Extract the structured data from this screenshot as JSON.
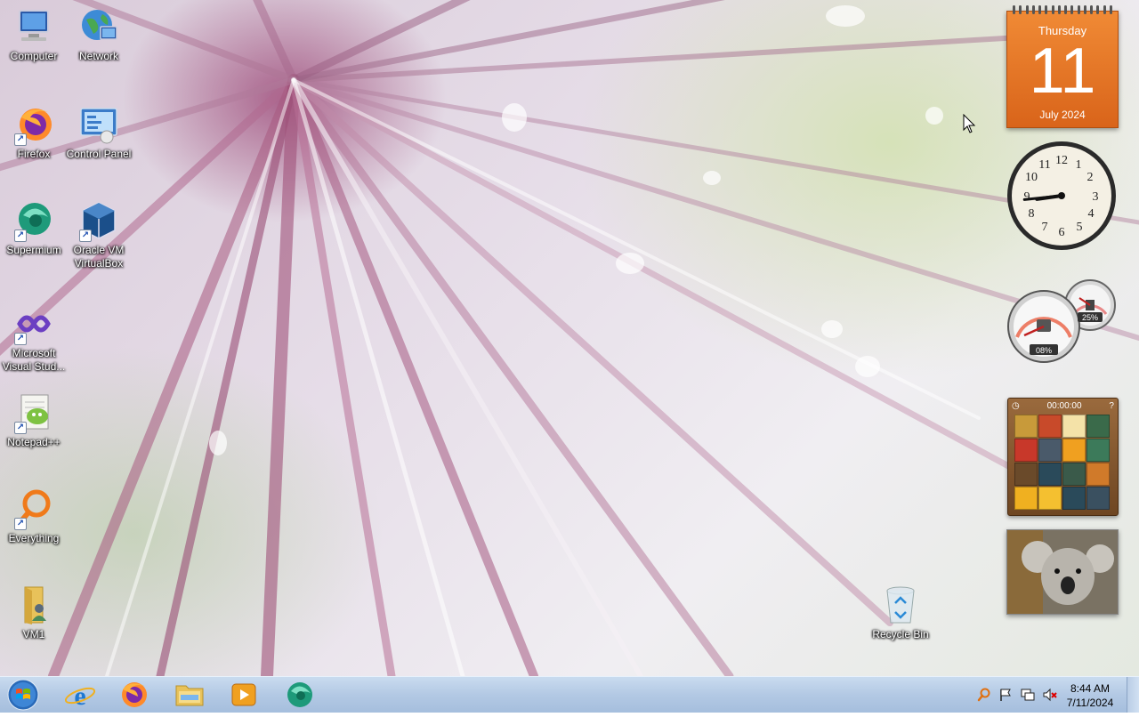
{
  "desktop_icons": [
    {
      "id": "computer",
      "label": "Computer",
      "icon": "computer-icon",
      "shortcut": false
    },
    {
      "id": "network",
      "label": "Network",
      "icon": "network-icon",
      "shortcut": false
    },
    {
      "id": "firefox",
      "label": "Firefox",
      "icon": "firefox-icon",
      "shortcut": true
    },
    {
      "id": "control-panel",
      "label": "Control Panel",
      "icon": "control-panel-icon",
      "shortcut": false
    },
    {
      "id": "supermium",
      "label": "Supermium",
      "icon": "supermium-icon",
      "shortcut": true
    },
    {
      "id": "virtualbox",
      "label": "Oracle VM VirtualBox",
      "icon": "virtualbox-icon",
      "shortcut": true
    },
    {
      "id": "visual-studio",
      "label": "Microsoft Visual Stud...",
      "icon": "visual-studio-icon",
      "shortcut": true
    },
    {
      "id": "notepadpp",
      "label": "Notepad++",
      "icon": "notepadpp-icon",
      "shortcut": true
    },
    {
      "id": "everything",
      "label": "Everything",
      "icon": "everything-search-icon",
      "shortcut": true
    },
    {
      "id": "vm1",
      "label": "VM1",
      "icon": "user-folder-icon",
      "shortcut": false
    },
    {
      "id": "recycle-bin",
      "label": "Recycle Bin",
      "icon": "recycle-bin-icon",
      "shortcut": false
    }
  ],
  "gadgets": {
    "calendar": {
      "weekday": "Thursday",
      "day": "11",
      "month_year": "July 2024"
    },
    "clock": {
      "hour": 8,
      "minute": 44
    },
    "cpu_meter": {
      "cpu_percent": "08%",
      "memory_percent": "25%"
    },
    "puzzle": {
      "timer": "00:00:00"
    }
  },
  "taskbar": {
    "pinned": [
      "windows-start-orb-icon",
      "internet-explorer-icon",
      "firefox-icon",
      "file-explorer-icon",
      "media-player-icon",
      "supermium-icon"
    ],
    "tray_icons": [
      "search-tray-icon",
      "action-center-flag-icon",
      "network-icon",
      "volume-muted-icon"
    ],
    "time": "8:44 AM",
    "date": "7/11/2024"
  },
  "colors": {
    "calendar_orange": "#e57526",
    "taskbar_blue": "#b3c9e4"
  }
}
